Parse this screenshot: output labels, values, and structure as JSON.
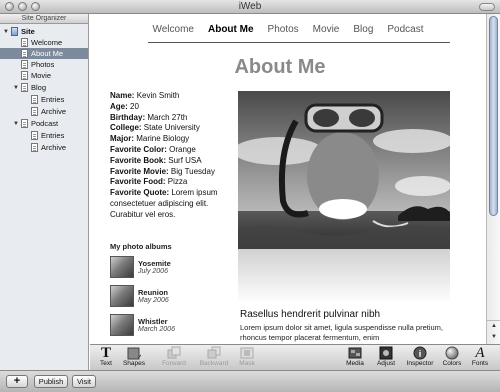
{
  "window": {
    "title": "iWeb"
  },
  "sidebar": {
    "header": "Site Organizer",
    "items": [
      {
        "label": "Site",
        "level": 0,
        "type": "site",
        "expanded": true
      },
      {
        "label": "Welcome",
        "level": 1,
        "type": "page"
      },
      {
        "label": "About Me",
        "level": 1,
        "type": "page",
        "selected": true
      },
      {
        "label": "Photos",
        "level": 1,
        "type": "page"
      },
      {
        "label": "Movie",
        "level": 1,
        "type": "page"
      },
      {
        "label": "Blog",
        "level": 1,
        "type": "page",
        "expanded": true
      },
      {
        "label": "Entries",
        "level": 2,
        "type": "page"
      },
      {
        "label": "Archive",
        "level": 2,
        "type": "page"
      },
      {
        "label": "Podcast",
        "level": 1,
        "type": "page",
        "expanded": true
      },
      {
        "label": "Entries",
        "level": 2,
        "type": "page"
      },
      {
        "label": "Archive",
        "level": 2,
        "type": "page"
      }
    ]
  },
  "nav": {
    "items": [
      "Welcome",
      "About Me",
      "Photos",
      "Movie",
      "Blog",
      "Podcast"
    ],
    "active": "About Me"
  },
  "page": {
    "title": "About Me",
    "bio": [
      {
        "key": "Name:",
        "value": "Kevin Smith"
      },
      {
        "key": "Age:",
        "value": "20"
      },
      {
        "key": "Birthday:",
        "value": "March 27th"
      },
      {
        "key": "College:",
        "value": "State University"
      },
      {
        "key": "Major:",
        "value": "Marine Biology"
      },
      {
        "key": "Favorite Color:",
        "value": "Orange"
      },
      {
        "key": "Favorite Book:",
        "value": "Surf USA"
      },
      {
        "key": "Favorite Movie:",
        "value": "Big Tuesday"
      },
      {
        "key": "Favorite Food:",
        "value": "Pizza"
      },
      {
        "key": "Favorite Quote:",
        "value": "Lorem ipsum consectetuer adipiscing elit. Curabitur vel eros."
      }
    ],
    "albums_title": "My photo albums",
    "albums": [
      {
        "name": "Yosemite",
        "date": "July 2006"
      },
      {
        "name": "Reunion",
        "date": "May 2006"
      },
      {
        "name": "Whistler",
        "date": "March 2006"
      }
    ],
    "post_title": "Rasellus hendrerit pulvinar nibh",
    "post_body": "Lorem ipsum dolor sit amet, ligula suspendisse nulla pretium, rhoncus tempor placerat fermentum, enim"
  },
  "toolbar": {
    "tools": [
      {
        "label": "Text",
        "icon": "text-icon"
      },
      {
        "label": "Shapes",
        "icon": "shapes-icon"
      },
      {
        "label": "Forward",
        "icon": "forward-icon",
        "disabled": true
      },
      {
        "label": "Backward",
        "icon": "backward-icon",
        "disabled": true
      },
      {
        "label": "Mask",
        "icon": "mask-icon",
        "disabled": true
      },
      {
        "label": "Media",
        "icon": "media-icon"
      },
      {
        "label": "Adjust",
        "icon": "adjust-icon"
      },
      {
        "label": "Inspector",
        "icon": "inspector-icon"
      },
      {
        "label": "Colors",
        "icon": "colors-icon"
      },
      {
        "label": "Fonts",
        "icon": "fonts-icon"
      }
    ]
  },
  "bottom": {
    "add_label": "+",
    "publish_label": "Publish",
    "visit_label": "Visit"
  }
}
